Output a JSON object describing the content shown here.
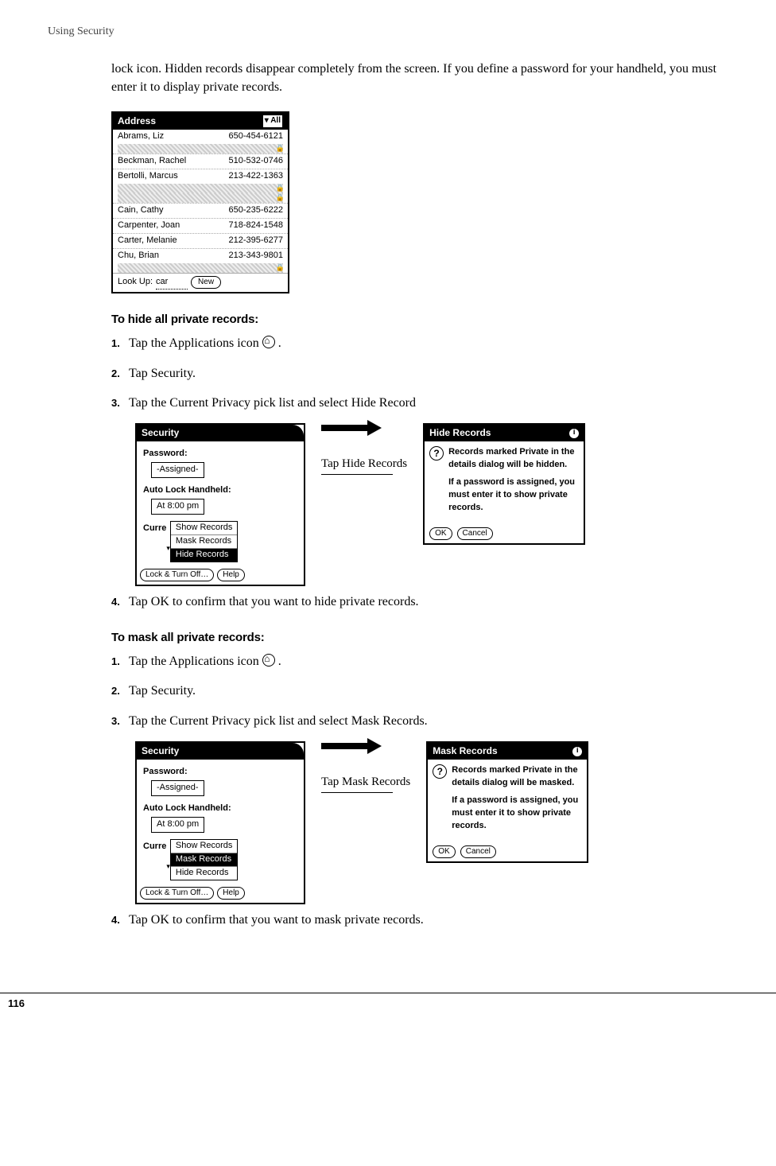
{
  "header": "Using Security",
  "page_number": "116",
  "intro": "lock icon. Hidden records disappear completely from the screen. If you define a password for your handheld, you must enter it to display private records.",
  "addr_screen": {
    "title": "Address",
    "filter": "▾ All",
    "rows": [
      {
        "name": "Abrams, Liz",
        "num": "650-454-6121"
      },
      {
        "name": "Beckman, Rachel",
        "num": "510-532-0746"
      },
      {
        "name": "Bertolli, Marcus",
        "num": "213-422-1363"
      },
      {
        "name": "Cain, Cathy",
        "num": "650-235-6222"
      },
      {
        "name": "Carpenter, Joan",
        "num": "718-824-1548"
      },
      {
        "name": "Carter, Melanie",
        "num": "212-395-6277"
      },
      {
        "name": "Chu, Brian",
        "num": "213-343-9801"
      }
    ],
    "lookup_label": "Look Up:",
    "lookup_value": "car",
    "new_btn": "New"
  },
  "hide": {
    "heading": "To hide all private records:",
    "steps": [
      "Tap the Applications icon",
      "Tap Security.",
      "Tap the Current Privacy pick list and select Hide Record",
      "Tap OK to confirm that you want to hide private records."
    ],
    "callout": "Tap Hide Records",
    "sec": {
      "title": "Security",
      "pwd_label": "Password:",
      "pwd_val": "-Assigned-",
      "lock_label": "Auto Lock Handheld:",
      "lock_val": "At 8:00 pm",
      "curr_label": "Curre",
      "items": [
        "Show Records",
        "Mask Records",
        "Hide Records"
      ],
      "selected": "Hide Records",
      "footer_a": "Lock & Turn Off…",
      "footer_b": "Help"
    },
    "dlg": {
      "title": "Hide Records",
      "p1": "Records marked Private in the details dialog will be hidden.",
      "p2": "If a password is assigned, you must enter it to show private records.",
      "ok": "OK",
      "cancel": "Cancel"
    }
  },
  "mask": {
    "heading": "To mask all private records:",
    "steps": [
      "Tap the Applications icon",
      "Tap Security.",
      "Tap the Current Privacy pick list and select Mask Records.",
      "Tap OK to confirm that you want to mask private records."
    ],
    "callout": "Tap Mask Records",
    "sec": {
      "title": "Security",
      "pwd_label": "Password:",
      "pwd_val": "-Assigned-",
      "lock_label": "Auto Lock Handheld:",
      "lock_val": "At 8:00 pm",
      "curr_label": "Curre",
      "items": [
        "Show Records",
        "Mask Records",
        "Hide Records"
      ],
      "selected": "Mask Records",
      "footer_a": "Lock & Turn Off…",
      "footer_b": "Help"
    },
    "dlg": {
      "title": "Mask Records",
      "p1": "Records marked Private in the details dialog will be masked.",
      "p2": "If a password is assigned, you must enter it to show private records.",
      "ok": "OK",
      "cancel": "Cancel"
    }
  }
}
